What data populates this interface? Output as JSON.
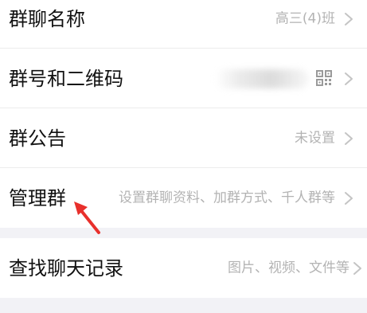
{
  "rows": {
    "group_name": {
      "label": "群聊名称",
      "value": "高三(4)班"
    },
    "group_number_qr": {
      "label": "群号和二维码",
      "value": ""
    },
    "announcement": {
      "label": "群公告",
      "value": "未设置"
    },
    "manage_group": {
      "label": "管理群",
      "value": "设置群聊资料、加群方式、千人群等"
    },
    "search_history": {
      "label": "查找聊天记录",
      "value": "图片、视频、文件等"
    }
  },
  "icons": {
    "chevron": "chevron-right-icon",
    "qr": "qr-code-icon",
    "annotation_arrow": "red-arrow-icon"
  },
  "colors": {
    "background": "#f2f2f6",
    "row_background": "#ffffff",
    "label": "#111111",
    "value": "#b3b3b3",
    "arrow": "#e8302c"
  }
}
